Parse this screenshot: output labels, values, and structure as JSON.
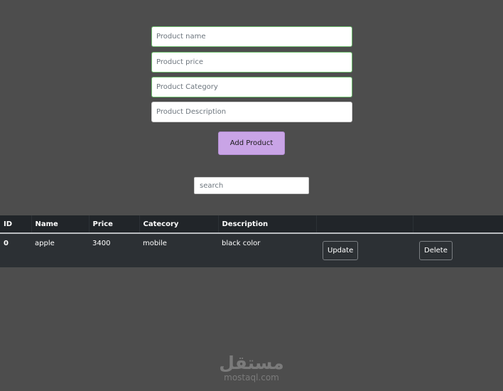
{
  "form": {
    "name_placeholder": "Product name",
    "price_placeholder": "Product price",
    "category_placeholder": "Product Category",
    "description_placeholder": "Product Description",
    "add_label": "Add Product"
  },
  "search": {
    "placeholder": "search"
  },
  "table": {
    "headers": {
      "id": "ID",
      "name": "Name",
      "price": "Price",
      "category": "Catecory",
      "description": "Description",
      "update": "",
      "delete": ""
    },
    "rows": [
      {
        "id": "0",
        "name": "apple",
        "price": "3400",
        "category": "mobile",
        "description": "black color",
        "update_label": "Update",
        "delete_label": "Delete"
      }
    ]
  },
  "watermark": {
    "arabic": "مستقل",
    "latin": "mostaql.com"
  }
}
